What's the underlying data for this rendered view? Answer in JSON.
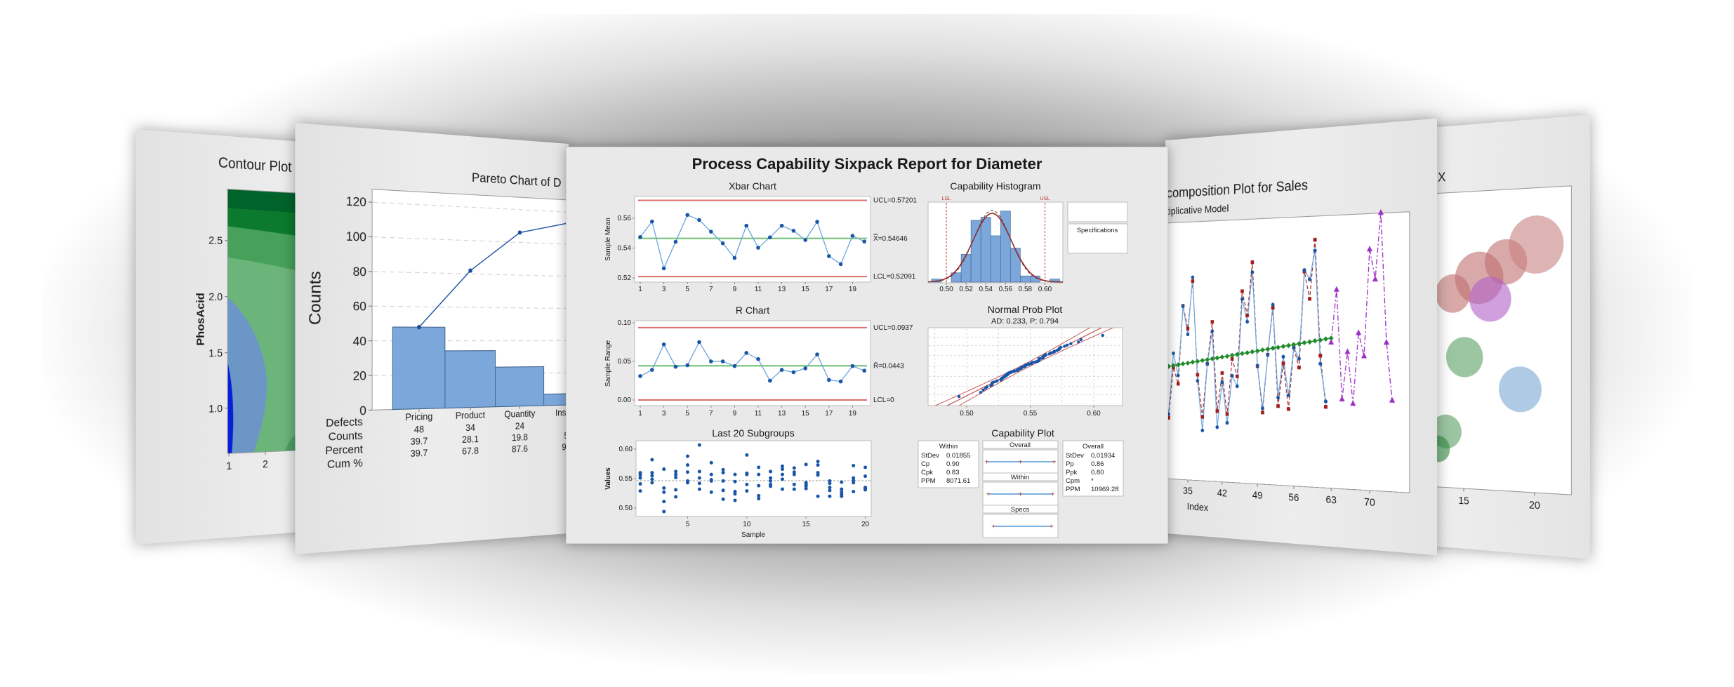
{
  "report_title": "Process Capability Sixpack Report for Diameter",
  "colors": {
    "limit": "#d9706c",
    "center": "#7cc47f",
    "series_line": "#6aa5dc",
    "marker": "#1a56a8",
    "bar": "#7ba7db",
    "bar_edge": "#3d5f88",
    "spec": "#c0392b",
    "trend": "#1f8a2a",
    "fits": "#a01d1d",
    "forecast": "#9b2fc4"
  },
  "chart_data": [
    {
      "type": "line",
      "title": "Xbar Chart",
      "ylabel": "Sample Mean",
      "x": [
        1,
        2,
        3,
        4,
        5,
        6,
        7,
        8,
        9,
        10,
        11,
        12,
        13,
        14,
        15,
        16,
        17,
        18,
        19,
        20
      ],
      "values": [
        0.5474,
        0.5578,
        0.5264,
        0.5442,
        0.5622,
        0.5588,
        0.551,
        0.5432,
        0.5334,
        0.555,
        0.5402,
        0.5472,
        0.555,
        0.5516,
        0.5454,
        0.5576,
        0.5346,
        0.5292,
        0.5482,
        0.5444
      ],
      "ucl": 0.57201,
      "center": 0.54646,
      "lcl": 0.52091,
      "ucl_label": "UCL=0.57201",
      "center_label": "X̿=0.54646",
      "lcl_label": "LCL=0.52091",
      "yticks": [
        0.52,
        0.54,
        0.56
      ],
      "xticks": [
        1,
        3,
        5,
        7,
        9,
        11,
        13,
        15,
        17,
        19
      ],
      "ylim": [
        0.5175,
        0.575
      ]
    },
    {
      "type": "line",
      "title": "R Chart",
      "ylabel": "Sample Range",
      "x": [
        1,
        2,
        3,
        4,
        5,
        6,
        7,
        8,
        9,
        10,
        11,
        12,
        13,
        14,
        15,
        16,
        17,
        18,
        19,
        20
      ],
      "values": [
        0.031,
        0.039,
        0.072,
        0.043,
        0.045,
        0.075,
        0.05,
        0.05,
        0.044,
        0.061,
        0.053,
        0.025,
        0.039,
        0.036,
        0.041,
        0.059,
        0.026,
        0.024,
        0.044,
        0.038
      ],
      "ucl": 0.0937,
      "center": 0.0443,
      "lcl": 0,
      "ucl_label": "UCL=0.0937",
      "center_label": "R̄=0.0443",
      "lcl_label": "LCL=0",
      "yticks": [
        0.0,
        0.05,
        0.1
      ],
      "xticks": [
        1,
        3,
        5,
        7,
        9,
        11,
        13,
        15,
        17,
        19
      ],
      "ylim": [
        -0.004,
        0.102
      ]
    },
    {
      "type": "bar",
      "title": "Capability Histogram",
      "bin_centers": [
        0.49,
        0.5,
        0.51,
        0.52,
        0.53,
        0.54,
        0.55,
        0.56,
        0.57,
        0.58,
        0.59,
        0.6,
        0.61
      ],
      "counts": [
        1,
        0,
        3,
        9,
        20,
        21,
        15,
        23,
        11,
        2,
        2,
        0,
        1
      ],
      "xticks": [
        0.5,
        0.52,
        0.54,
        0.56,
        0.58,
        0.6
      ],
      "xlim": [
        0.4815,
        0.618
      ],
      "lsl": 0.5,
      "usl": 0.6,
      "lsl_label": "LSL",
      "usl_label": "USL",
      "mean": 0.54646,
      "stdev_overall": 0.01934,
      "stdev_within": 0.01855,
      "legend": [
        "Overall",
        "Within"
      ],
      "specs_title": "Specifications",
      "specs": [
        [
          "LSL",
          "0.5"
        ],
        [
          "USL",
          "0.6"
        ]
      ]
    },
    {
      "type": "scatter",
      "title": "Normal Prob Plot",
      "subtitle": "AD: 0.233, P: 0.794",
      "xticks": [
        0.5,
        0.55,
        0.6
      ],
      "xlim": [
        0.4696,
        0.6227
      ]
    },
    {
      "type": "scatter",
      "title": "Last 20 Subgroups",
      "xlabel": "Sample",
      "ylabel": "Values",
      "xticks": [
        5,
        10,
        15,
        20
      ],
      "yticks": [
        0.5,
        0.55,
        0.6
      ],
      "ylim": [
        0.4855,
        0.6145
      ],
      "subgroups": [
        [
          0.56,
          0.556,
          0.551,
          0.541,
          0.529
        ],
        [
          0.582,
          0.56,
          0.555,
          0.549,
          0.543
        ],
        [
          0.566,
          0.534,
          0.527,
          0.511,
          0.494
        ],
        [
          0.562,
          0.557,
          0.552,
          0.531,
          0.519
        ],
        [
          0.588,
          0.573,
          0.561,
          0.546,
          0.543
        ],
        [
          0.607,
          0.562,
          0.551,
          0.542,
          0.532
        ],
        [
          0.577,
          0.557,
          0.548,
          0.546,
          0.527
        ],
        [
          0.565,
          0.56,
          0.546,
          0.53,
          0.515
        ],
        [
          0.557,
          0.545,
          0.528,
          0.524,
          0.513
        ],
        [
          0.59,
          0.559,
          0.557,
          0.54,
          0.529
        ],
        [
          0.569,
          0.557,
          0.538,
          0.521,
          0.516
        ],
        [
          0.562,
          0.551,
          0.546,
          0.54,
          0.537
        ],
        [
          0.571,
          0.566,
          0.557,
          0.549,
          0.532
        ],
        [
          0.568,
          0.561,
          0.557,
          0.54,
          0.532
        ],
        [
          0.574,
          0.543,
          0.54,
          0.537,
          0.533
        ],
        [
          0.579,
          0.573,
          0.56,
          0.556,
          0.52
        ],
        [
          0.546,
          0.542,
          0.535,
          0.53,
          0.52
        ],
        [
          0.544,
          0.532,
          0.527,
          0.523,
          0.52
        ],
        [
          0.572,
          0.551,
          0.547,
          0.543,
          0.528
        ],
        [
          0.569,
          0.554,
          0.535,
          0.533,
          0.531
        ]
      ]
    },
    {
      "type": "table",
      "title": "Capability Plot",
      "within": {
        "title": "Within",
        "rows": [
          [
            "StDev",
            "0.01855"
          ],
          [
            "Cp",
            "0.90"
          ],
          [
            "Cpk",
            "0.83"
          ],
          [
            "PPM",
            "8071.61"
          ]
        ]
      },
      "overall": {
        "title": "Overall",
        "rows": [
          [
            "StDev",
            "0.01934"
          ],
          [
            "Pp",
            "0.86"
          ],
          [
            "Ppk",
            "0.80"
          ],
          [
            "Cpm",
            "*"
          ],
          [
            "PPM",
            "10969.28"
          ]
        ]
      },
      "interval_titles": [
        "Overall",
        "Within",
        "Specs"
      ]
    },
    {
      "type": "heatmap",
      "title": "Contour Plot o",
      "ylabel": "PhosAcid",
      "yticks": [
        "1.0",
        "1.5",
        "2.0",
        "2.5"
      ],
      "xticks": [
        "1",
        "2"
      ],
      "level_colors": [
        "#00632a",
        "#0b7a2f",
        "#47a15b",
        "#6cb57a",
        "#6c96c6",
        "#0b1fd8"
      ]
    },
    {
      "type": "bar",
      "title": "Pareto Chart of D",
      "ylabel": "Counts",
      "yticks": [
        0,
        20,
        40,
        60,
        80,
        100,
        120
      ],
      "ylim": [
        0,
        128
      ],
      "categories": [
        "Pricing",
        "Product",
        "Quantity",
        "Instruc"
      ],
      "values": [
        48,
        34,
        24,
        7
      ],
      "cumulative": [
        48,
        82,
        106,
        113
      ],
      "table": {
        "row_labels": [
          "Defects",
          "Counts",
          "Percent",
          "Cum %"
        ],
        "counts": [
          "48",
          "34",
          "24",
          ""
        ],
        "percent": [
          "39.7",
          "28.1",
          "19.8",
          "5."
        ],
        "cum_percent": [
          "39.7",
          "67.8",
          "87.6",
          "93."
        ]
      }
    },
    {
      "type": "line",
      "title": "composition Plot for Sales",
      "subtitle": "tiplicative Model",
      "xlabel": "Index",
      "xticks": [
        35,
        42,
        49,
        56,
        63,
        70
      ],
      "actual": {
        "start_index": 30,
        "values": [
          32.5,
          19.5,
          43.5,
          34.8,
          62,
          51,
          73.3,
          32.8,
          13.5,
          39.5,
          52.2,
          15,
          32.5,
          16.8,
          35,
          31,
          64.5,
          55.8,
          74.7,
          39,
          22.8,
          43.2,
          62.2,
          27,
          42.5,
          28,
          46,
          41.8,
          75,
          71.5,
          82.2,
          40,
          26
        ]
      },
      "fits": {
        "start_index": 30,
        "values": [
          32.8,
          18,
          38,
          31.5,
          62.2,
          53.2,
          71.8,
          35.2,
          18.8,
          39.5,
          55.8,
          21.2,
          36,
          20.2,
          41.5,
          34.8,
          67.5,
          58.2,
          78.5,
          38.8,
          21.2,
          43.2,
          61,
          23.8,
          40,
          22.8,
          46,
          38.5,
          74.5,
          64.2,
          86.2,
          43,
          24
        ]
      },
      "trend": {
        "start_index": 30,
        "values": [
          38.0,
          38.3,
          38.7,
          39.0,
          39.4,
          39.7,
          40.1,
          40.4,
          40.8,
          41.1,
          41.5,
          41.8,
          42.2,
          42.5,
          42.9,
          43.2,
          43.6,
          43.9,
          44.3,
          44.6,
          45.0,
          45.3,
          45.7,
          46.0,
          46.4,
          46.7,
          47.1,
          47.4,
          47.8,
          48.1,
          48.5,
          48.8,
          49.2,
          49.5
        ]
      },
      "forecasts": {
        "start_index": 63,
        "values": [
          48,
          67.5,
          27,
          44.5,
          25.5,
          51.5,
          43,
          82,
          71,
          95.2,
          48,
          27
        ]
      }
    },
    {
      "type": "scatter",
      "title": "X",
      "xticks": [
        15,
        20
      ],
      "bubbles": [
        {
          "x": 14.2,
          "y": 65.8,
          "size": 26,
          "color": "#c07070"
        },
        {
          "x": 16.1,
          "y": 70.9,
          "size": 35,
          "color": "#c07070"
        },
        {
          "x": 18.0,
          "y": 76.0,
          "size": 30,
          "color": "#c07070"
        },
        {
          "x": 20.1,
          "y": 81.4,
          "size": 38,
          "color": "#c88080"
        },
        {
          "x": 16.9,
          "y": 63.7,
          "size": 30,
          "color": "#b061c8"
        },
        {
          "x": 15.05,
          "y": 44.3,
          "size": 27,
          "color": "#5a9e63"
        },
        {
          "x": 13.7,
          "y": 19.0,
          "size": 23,
          "color": "#5a9e63"
        },
        {
          "x": 13.1,
          "y": 13.0,
          "size": 18,
          "color": "#2f8a3e"
        },
        {
          "x": 19.0,
          "y": 33.8,
          "size": 30,
          "color": "#7aa6d2"
        }
      ]
    }
  ]
}
